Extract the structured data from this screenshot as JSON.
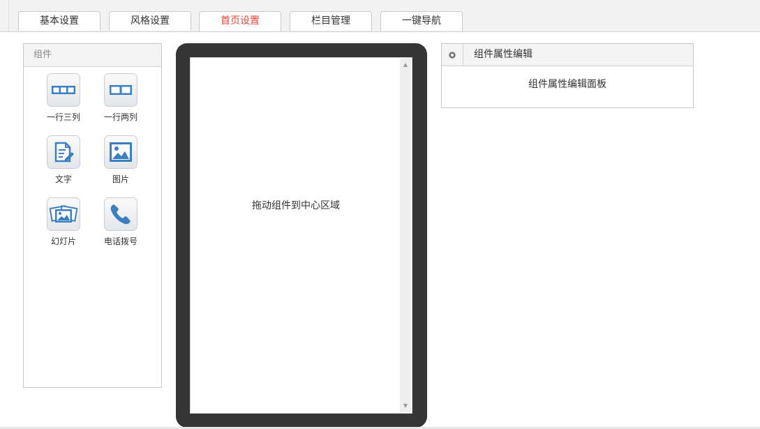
{
  "tabs": [
    {
      "label": "基本设置",
      "active": false
    },
    {
      "label": "风格设置",
      "active": false
    },
    {
      "label": "首页设置",
      "active": true
    },
    {
      "label": "栏目管理",
      "active": false
    },
    {
      "label": "一键导航",
      "active": false
    }
  ],
  "components_panel": {
    "title": "组件",
    "items": [
      {
        "label": "一行三列",
        "icon": "three-columns-icon"
      },
      {
        "label": "一行两列",
        "icon": "two-columns-icon"
      },
      {
        "label": "文字",
        "icon": "text-document-icon"
      },
      {
        "label": "图片",
        "icon": "image-icon"
      },
      {
        "label": "幻灯片",
        "icon": "slideshow-icon"
      },
      {
        "label": "电话拨号",
        "icon": "phone-icon"
      }
    ]
  },
  "preview": {
    "drop_hint": "拖动组件到中心区域"
  },
  "properties_panel": {
    "title": "组件属性编辑",
    "body": "组件属性编辑面板",
    "icon": "gear-icon"
  },
  "colors": {
    "active_tab": "#e0483a",
    "icon_blue": "#3a7fc1",
    "phone_frame": "#353535"
  }
}
